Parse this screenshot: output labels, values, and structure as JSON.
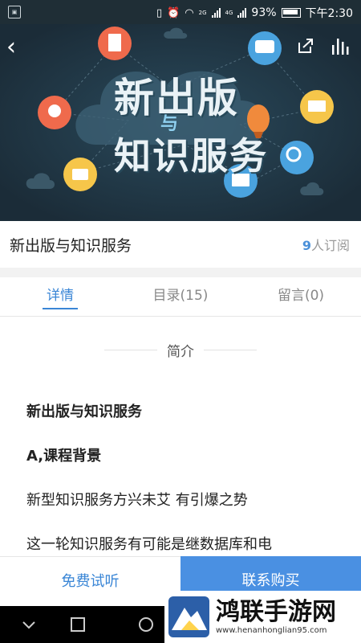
{
  "status": {
    "network1": "2G",
    "network2": "4G",
    "battery": "93%",
    "time": "下午2:30"
  },
  "banner": {
    "title_line1": "新出版",
    "title_line2": "知识服务",
    "connector": "与"
  },
  "course": {
    "title": "新出版与知识服务",
    "subscribers_count": "9",
    "subscribers_suffix": "人订阅"
  },
  "tabs": [
    {
      "label": "详情",
      "active": true
    },
    {
      "label": "目录(15)",
      "active": false
    },
    {
      "label": "留言(0)",
      "active": false
    }
  ],
  "intro": {
    "heading": "简介",
    "paragraphs": [
      {
        "text": "新出版与知识服务",
        "bold": true
      },
      {
        "text": "A,课程背景",
        "bold": true
      },
      {
        "text": "新型知识服务方兴未艾 有引爆之势",
        "bold": false
      },
      {
        "text": "这一轮知识服务有可能是继数据库和电",
        "bold": false
      }
    ]
  },
  "footer": {
    "try_label": "免费试听",
    "buy_label": "联系购买"
  },
  "watermark": {
    "name": "鸿联手游网",
    "url": "www.henanhonglian95.com"
  },
  "colors": {
    "accent": "#3a86d6",
    "buy_button": "#4a90e2",
    "banner_bg": "#1d3140"
  }
}
